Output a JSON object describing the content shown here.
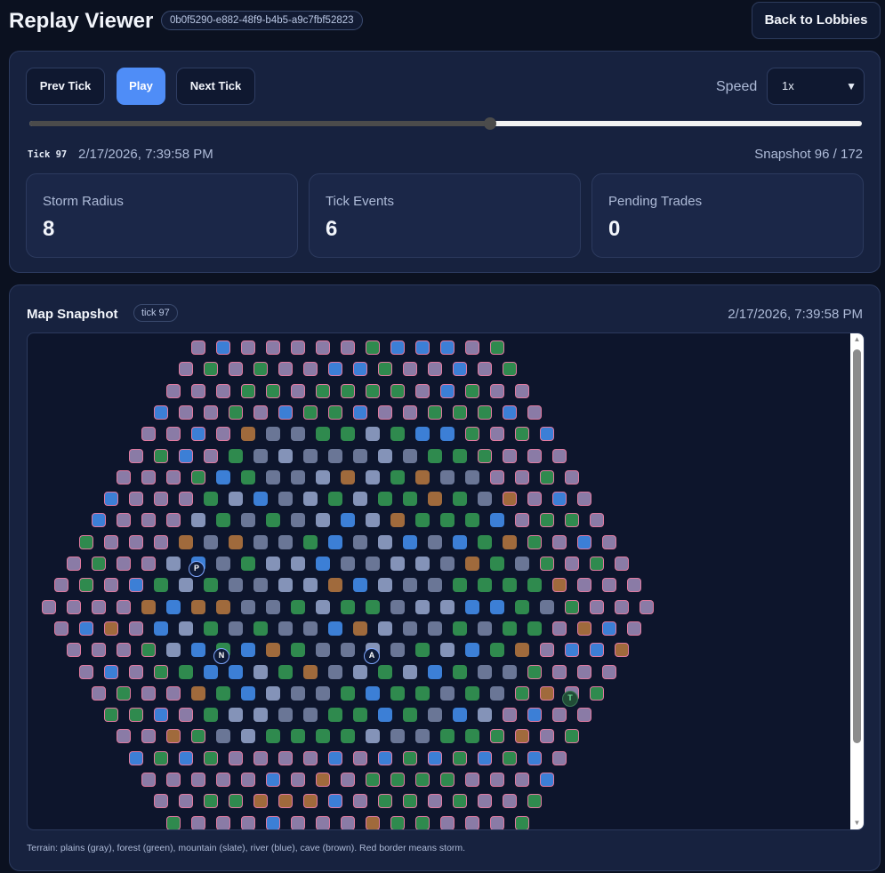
{
  "header": {
    "title": "Replay Viewer",
    "replay_id": "0b0f5290-e882-48f9-b4b5-a9c7fbf52823",
    "back_label": "Back to Lobbies"
  },
  "controls": {
    "prev_label": "Prev Tick",
    "play_label": "Play",
    "next_label": "Next Tick",
    "speed_label": "Speed",
    "speed_value": "1x",
    "slider_progress": 0.553,
    "tick_label": "Tick 97",
    "tick_time": "2/17/2026, 7:39:58 PM",
    "snapshot_label": "Snapshot 96 / 172"
  },
  "stats": [
    {
      "label": "Storm Radius",
      "value": "8"
    },
    {
      "label": "Tick Events",
      "value": "6"
    },
    {
      "label": "Pending Trades",
      "value": "0"
    }
  ],
  "map": {
    "title": "Map Snapshot",
    "tick_badge": "tick 97",
    "time": "2/17/2026, 7:39:58 PM",
    "legend": "Terrain: plains (gray), forest (green), mountain (slate), river (blue), cave (brown). Red border means storm.",
    "markers": [
      {
        "label": "P",
        "kind": "player"
      },
      {
        "label": "N",
        "kind": "player"
      },
      {
        "label": "A",
        "kind": "player"
      },
      {
        "label": "T",
        "kind": "trade"
      }
    ]
  },
  "colors": {
    "accent": "#4f8df7",
    "plains": "#6a7696",
    "forest": "#2f8a4e",
    "mountain": "#8493b8",
    "river": "#3c7fd6",
    "cave": "#a06a3c",
    "storm_border": "#e07aa0"
  }
}
